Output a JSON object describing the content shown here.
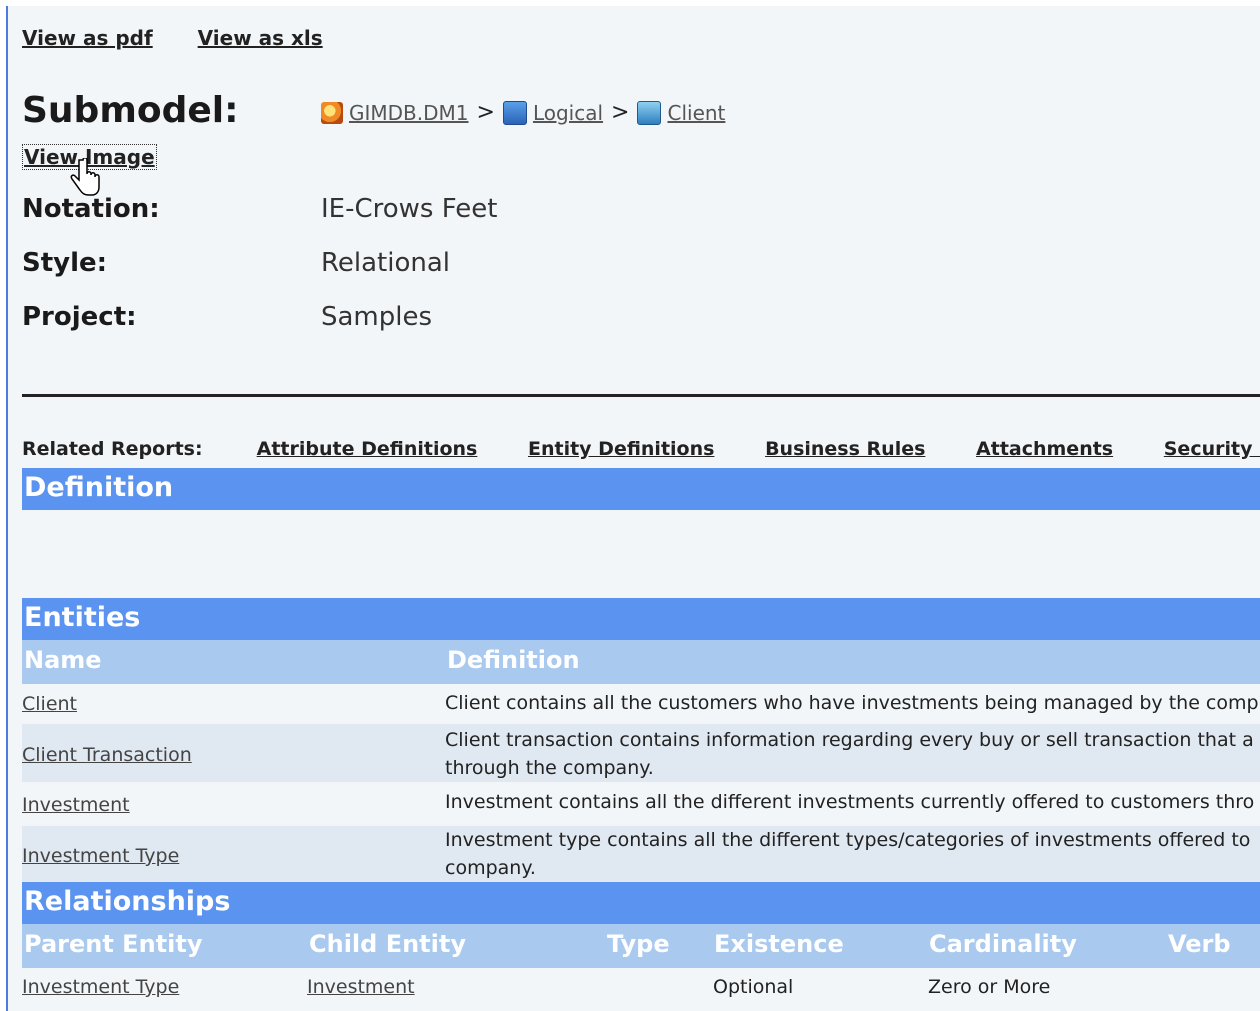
{
  "top_links": {
    "pdf": "View as pdf",
    "xls": "View as xls"
  },
  "submodel": {
    "label": "Submodel:",
    "breadcrumb": [
      {
        "icon": "database-icon",
        "label": "GIMDB.DM1"
      },
      {
        "icon": "logical-model-icon",
        "label": "Logical"
      },
      {
        "icon": "submodel-icon",
        "label": "Client"
      }
    ],
    "separator": ">",
    "view_image": "View Image"
  },
  "properties": [
    {
      "label": "Notation:",
      "value": "IE-Crows Feet"
    },
    {
      "label": "Style:",
      "value": "Relational"
    },
    {
      "label": "Project:",
      "value": "Samples"
    }
  ],
  "related_reports": {
    "label": "Related Reports:",
    "links": [
      "Attribute Definitions",
      "Entity Definitions",
      "Business Rules",
      "Attachments",
      "Security I"
    ]
  },
  "definition": {
    "title": "Definition",
    "text": ""
  },
  "entities": {
    "title": "Entities",
    "columns": [
      "Name",
      "Definition"
    ],
    "rows": [
      {
        "name": "Client",
        "definition": "Client contains all the customers who have investments being managed by the comp"
      },
      {
        "name": "Client Transaction",
        "definition": "Client transaction contains information regarding every buy or sell transaction that a",
        "definition2": "through the company."
      },
      {
        "name": "Investment",
        "definition": "Investment contains all the different investments currently offered to customers thro"
      },
      {
        "name": "Investment Type",
        "definition": "Investment type contains all the different types/categories of investments offered to",
        "definition2": "company."
      }
    ]
  },
  "relationships": {
    "title": "Relationships",
    "columns": [
      "Parent Entity",
      "Child Entity",
      "Type",
      "Existence",
      "Cardinality",
      "Verb"
    ],
    "rows": [
      {
        "parent": "Investment Type",
        "child": "Investment",
        "type": "",
        "existence": "Optional",
        "cardinality": "Zero or More",
        "verb": ""
      }
    ]
  },
  "colors": {
    "section_header": "#5b93f0",
    "column_header": "#a9c9ef",
    "alt_row": "#e0e8f1",
    "page_bg": "#f3f6f9"
  }
}
